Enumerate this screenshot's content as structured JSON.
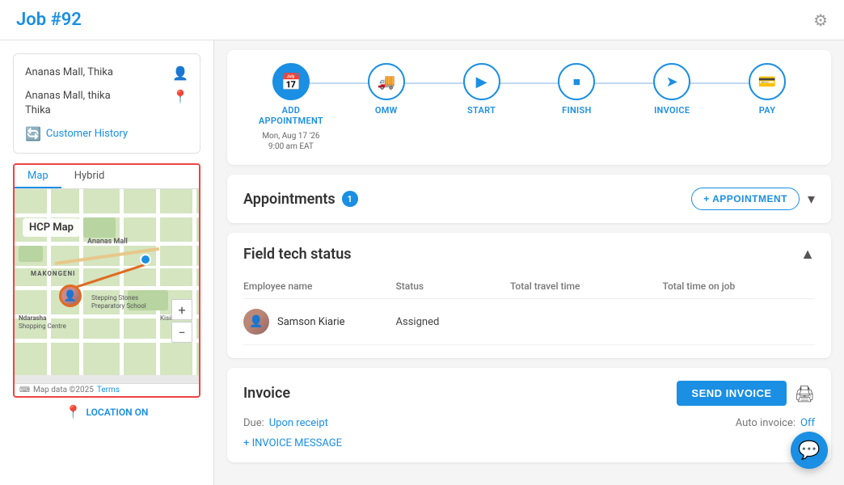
{
  "header": {
    "title": "Job ",
    "job_number": "#92",
    "settings_icon": "⚙"
  },
  "left": {
    "address_line1": "Ananas Mall, Thika",
    "address_line2": "Ananas Mall, thika\nThika",
    "customer_history_label": "Customer History",
    "map": {
      "tab_map": "Map",
      "tab_hybrid": "Hybrid",
      "map_label": "HCP Map",
      "footer_text": "Map data ©2025",
      "footer_terms": "Terms"
    },
    "location_on_label": "LOCATION ON"
  },
  "workflow": {
    "steps": [
      {
        "id": "add-appointment",
        "icon": "📅",
        "label": "ADD\nAPPOINTMENT",
        "sub": "Mon, Aug 17 '26\n9:00 am EAT",
        "active": true
      },
      {
        "id": "omw",
        "icon": "🚚",
        "label": "OMW",
        "sub": "",
        "active": false
      },
      {
        "id": "start",
        "icon": "▶",
        "label": "START",
        "sub": "",
        "active": false
      },
      {
        "id": "finish",
        "icon": "⏹",
        "label": "FINISH",
        "sub": "",
        "active": false
      },
      {
        "id": "invoice",
        "icon": "➤",
        "label": "INVOICE",
        "sub": "",
        "active": false
      },
      {
        "id": "pay",
        "icon": "💳",
        "label": "PAY",
        "sub": "",
        "active": false
      }
    ]
  },
  "appointments": {
    "title": "Appointments",
    "count": "1",
    "add_button_label": "+ APPOINTMENT",
    "chevron": "▾"
  },
  "field_tech": {
    "title": "Field tech status",
    "chevron": "▲",
    "columns": {
      "employee_name": "Employee name",
      "status": "Status",
      "total_travel_time": "Total travel time",
      "total_time_on_job": "Total time on job"
    },
    "rows": [
      {
        "name": "Samson Kiarie",
        "status": "Assigned",
        "travel_time": "",
        "time_on_job": ""
      }
    ]
  },
  "invoice": {
    "title": "Invoice",
    "send_button_label": "SEND INVOICE",
    "print_icon": "🖨",
    "due_label": "Due:",
    "due_value": "Upon receipt",
    "auto_invoice_label": "Auto invoice:",
    "auto_invoice_value": "Off",
    "add_message_label": "+ INVOICE MESSAGE"
  },
  "chat": {
    "icon": "💬"
  }
}
